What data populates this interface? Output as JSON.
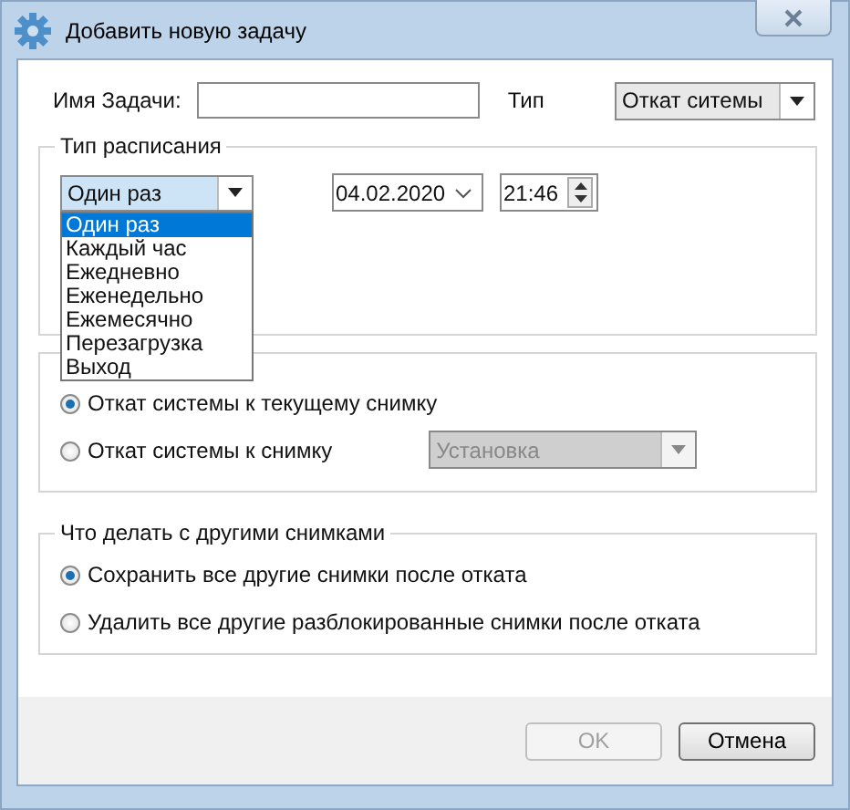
{
  "window": {
    "title": "Добавить новую задачу"
  },
  "task": {
    "name_label": "Имя Задачи:",
    "type_label": "Тип",
    "type_value": "Откат ситемы"
  },
  "schedule": {
    "legend": "Тип расписания",
    "frequency": {
      "value": "Один раз",
      "expanded": true,
      "options": [
        {
          "label": "Один раз",
          "selected": true
        },
        {
          "label": "Каждый час",
          "selected": false
        },
        {
          "label": "Ежедневно",
          "selected": false
        },
        {
          "label": "Еженедельно",
          "selected": false
        },
        {
          "label": "Ежемесячно",
          "selected": false
        },
        {
          "label": "Перезагрузка",
          "selected": false
        },
        {
          "label": "Выход",
          "selected": false
        }
      ]
    },
    "date": "04.02.2020",
    "time": "21:46"
  },
  "rollback": {
    "options": [
      {
        "label": "Откат системы к текущему снимку",
        "selected": true
      },
      {
        "label": "Откат системы к снимку",
        "selected": false
      }
    ],
    "snapshot": {
      "value": "Установка",
      "disabled": true
    }
  },
  "other_snapshots": {
    "legend": "Что делать с другими снимками",
    "options": [
      {
        "label": "Сохранить все другие снимки после отката",
        "selected": true
      },
      {
        "label": "Удалить все другие разблокированные снимки после отката",
        "selected": false
      }
    ]
  },
  "buttons": [
    {
      "label": "OK",
      "disabled": true
    },
    {
      "label": "Отмена",
      "disabled": false
    }
  ]
}
